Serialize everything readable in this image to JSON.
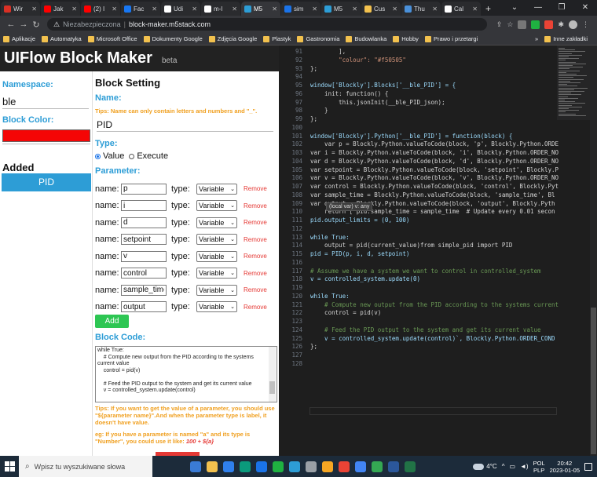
{
  "browser": {
    "tabs": [
      {
        "label": "Wir",
        "color": "#d93025",
        "active": false
      },
      {
        "label": "Jak",
        "color": "#ff0000",
        "active": false
      },
      {
        "label": "(2) I",
        "color": "#ff0000",
        "active": false
      },
      {
        "label": "Fac",
        "color": "#1877f2",
        "active": false
      },
      {
        "label": "Udi",
        "color": "#ffffff",
        "active": false
      },
      {
        "label": "m-l",
        "color": "#ffffff",
        "active": false
      },
      {
        "label": "M5",
        "color": "#2d9dd6",
        "active": true
      },
      {
        "label": "sim",
        "color": "#1a73e8",
        "active": false
      },
      {
        "label": "M5",
        "color": "#2d9dd6",
        "active": false
      },
      {
        "label": "Cus",
        "color": "#f2c14e",
        "active": false
      },
      {
        "label": "Thu",
        "color": "#4a90d9",
        "active": false
      },
      {
        "label": "Cal",
        "color": "#ffffff",
        "active": false
      }
    ],
    "new_tab": "+",
    "window_controls": [
      "⌄",
      "—",
      "❐",
      "✕"
    ],
    "address": {
      "security": "Niezabezpieczona",
      "url": "block-maker.m5stack.com"
    },
    "bookmarks": [
      {
        "label": "Aplikacje"
      },
      {
        "label": "Automatyka"
      },
      {
        "label": "Microsoft Office"
      },
      {
        "label": "Dokumenty Google"
      },
      {
        "label": "Zdjęcia Google"
      },
      {
        "label": "Plastyk"
      },
      {
        "label": "Gastronomia"
      },
      {
        "label": "Budowlanka"
      },
      {
        "label": "Hobby"
      },
      {
        "label": "Prawo i przetargi"
      }
    ],
    "bookmarks_more": "»",
    "bookmarks_other": "Inne zakładki"
  },
  "app": {
    "title": "UIFlow Block Maker",
    "badge": "beta",
    "sidebar": {
      "namespace_label": "Namespace:",
      "namespace_value": "ble",
      "block_color_label": "Block Color:",
      "block_color": "#f50505",
      "added_label": "Added",
      "added_items": [
        "PID"
      ]
    },
    "settings": {
      "heading": "Block Setting",
      "name_label": "Name:",
      "name_tip": "Tips: Name can only contain letters and numbers and \"_\".",
      "name_value": "PID",
      "type_label": "Type:",
      "type_options": [
        "Value",
        "Execute"
      ],
      "type_selected": "Value",
      "parameter_label": "Parameter:",
      "param_name_label": "name:",
      "param_type_label": "type:",
      "remove_label": "Remove",
      "parameters": [
        {
          "name": "p",
          "type": "Variable"
        },
        {
          "name": "i",
          "type": "Variable"
        },
        {
          "name": "d",
          "type": "Variable"
        },
        {
          "name": "setpoint",
          "type": "Variable"
        },
        {
          "name": "v",
          "type": "Variable"
        },
        {
          "name": "control",
          "type": "Variable"
        },
        {
          "name": "sample_time",
          "type": "Variable"
        },
        {
          "name": "output",
          "type": "Variable"
        }
      ],
      "add_button": "Add",
      "block_code_label": "Block Code:",
      "block_code": "while True:\n    # Compute new output from the PID according to the systems current value\n    control = pid(v)\n\n    # Feed the PID output to the system and get its current value\n    v = controlled_system.update(control)",
      "tip_param_a": "Tips: If you want to get the value of a parameter, you should use \"${parameter name}\".And when the parameter type is label, it doesn't have value.",
      "tip_param_b_prefix": "eg: If you have a parameter is named \"a\" and its type is \"Number\", you could use it like: ",
      "tip_param_b_example": "100 + ${a}"
    }
  },
  "editor": {
    "tooltip": "(local var) v: any",
    "lines": [
      {
        "n": "91",
        "code": "        ],"
      },
      {
        "n": "92",
        "code": "        \"colour\": \"#f50505\""
      },
      {
        "n": "93",
        "code": "};"
      },
      {
        "n": "94",
        "code": ""
      },
      {
        "n": "95",
        "code": "window['Blockly'].Blocks['__ble_PID'] = {"
      },
      {
        "n": "96",
        "code": "    init: function() {"
      },
      {
        "n": "97",
        "code": "        this.jsonInit(__ble_PID_json);"
      },
      {
        "n": "98",
        "code": "    }"
      },
      {
        "n": "99",
        "code": "};"
      },
      {
        "n": "100",
        "code": ""
      },
      {
        "n": "101",
        "code": "window['Blockly'].Python['__ble_PID'] = function(block) {"
      },
      {
        "n": "102",
        "code": "    var p = Blockly.Python.valueToCode(block, 'p', Blockly.Python.ORDE"
      },
      {
        "n": "103",
        "code": "var i = Blockly.Python.valueToCode(block, 'i', Blockly.Python.ORDER_NO"
      },
      {
        "n": "104",
        "code": "var d = Blockly.Python.valueToCode(block, 'd', Blockly.Python.ORDER_NO"
      },
      {
        "n": "105",
        "code": "var setpoint = Blockly.Python.valueToCode(block, 'setpoint', Blockly.P"
      },
      {
        "n": "106",
        "code": "var v = Blockly.Python.valueToCode(block, 'v', Blockly.Python.ORDER_NO"
      },
      {
        "n": "107",
        "code": "var control = Blockly.Python.valueToCode(block, 'control', Blockly.Pyt"
      },
      {
        "n": "108",
        "code": "var sample_time = Blockly.Python.valueToCode(block, 'sample_time', Bl"
      },
      {
        "n": "109",
        "code": "var output = Blockly.Python.valueToCode(block, 'output', Blockly.Pyth"
      },
      {
        "n": "110",
        "code": "    return [`pid.sample_time = sample_time  # Update every 0.01 secon"
      },
      {
        "n": "111",
        "code": "pid.output_limits = (0, 100)"
      },
      {
        "n": "112",
        "code": ""
      },
      {
        "n": "113",
        "code": "while True:"
      },
      {
        "n": "114",
        "code": "    output = pid(current_value)from simple_pid import PID"
      },
      {
        "n": "115",
        "code": "pid = PID(p, i, d, setpoint)"
      },
      {
        "n": "116",
        "code": ""
      },
      {
        "n": "117",
        "code": "# Assume we have a system we want to control in controlled_system"
      },
      {
        "n": "118",
        "code": "v = controlled_system.update(0)"
      },
      {
        "n": "119",
        "code": ""
      },
      {
        "n": "120",
        "code": "while True:"
      },
      {
        "n": "121",
        "code": "    # Compute new output from the PID according to the systems current"
      },
      {
        "n": "122",
        "code": "    control = pid(v)"
      },
      {
        "n": "123",
        "code": ""
      },
      {
        "n": "124",
        "code": "    # Feed the PID output to the system and get its current value"
      },
      {
        "n": "125",
        "code": "    v = controlled_system.update(control)`, Blockly.Python.ORDER_COND"
      },
      {
        "n": "126",
        "code": "};"
      },
      {
        "n": "127",
        "code": ""
      },
      {
        "n": "128",
        "code": ""
      }
    ]
  },
  "taskbar": {
    "search_placeholder": "Wpisz tu wyszukiwane słowa",
    "temperature": "4°C",
    "lang_top": "POL",
    "lang_bottom": "PLP",
    "time": "20:42",
    "date": "2023-01-05",
    "app_icon_colors": [
      "#3a7bd5",
      "#f2c14e",
      "#2f80ed",
      "#0b9a7c",
      "#1a73e8",
      "#1fb141",
      "#2d9dd6",
      "#9aa0a6",
      "#f5a623",
      "#ea4335",
      "#4285f4",
      "#34a853",
      "#2b579a",
      "#217346"
    ]
  }
}
